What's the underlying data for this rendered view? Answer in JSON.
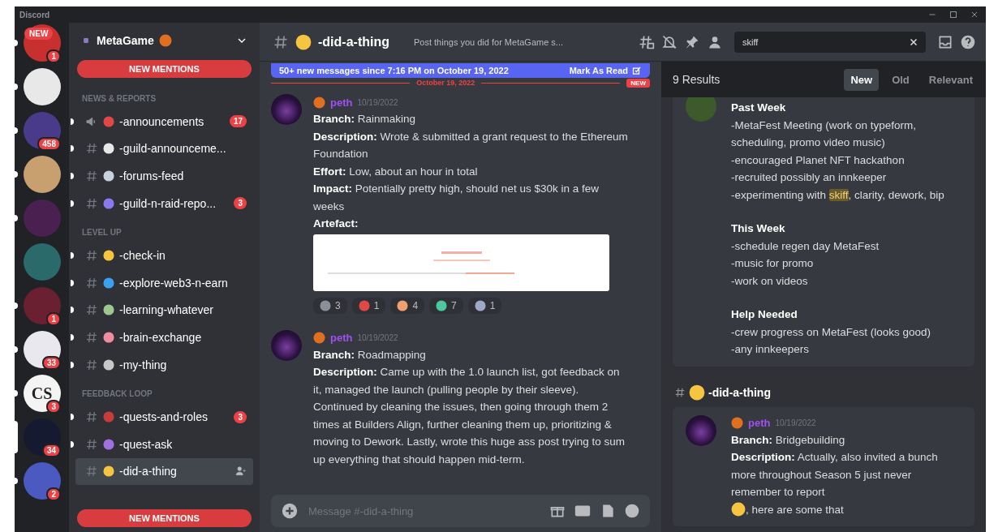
{
  "window": {
    "title": "Discord"
  },
  "servers": [
    {
      "tag": "NEW",
      "badge": "1",
      "unread": true,
      "selected": false
    },
    {
      "unread": true,
      "selected": false
    },
    {
      "badge": "458",
      "unread": true,
      "selected": false
    },
    {
      "unread": true,
      "selected": false
    },
    {
      "unread": true,
      "selected": false
    },
    {
      "unread": false,
      "selected": false
    },
    {
      "badge": "1",
      "unread": true,
      "selected": false
    },
    {
      "badge": "33",
      "unread": true,
      "selected": false
    },
    {
      "label": "CS",
      "badge": "3",
      "unread": true,
      "selected": false
    },
    {
      "badge": "34",
      "unread": false,
      "selected": true
    },
    {
      "badge": "2",
      "unread": true,
      "selected": false
    }
  ],
  "sidebar": {
    "server_name": "MetaGame",
    "top_pill": "NEW MENTIONS",
    "bottom_pill": "NEW MENTIONS",
    "categories": [
      {
        "name": "NEWS & REPORTS",
        "channels": [
          {
            "kind": "announcement",
            "name": "-announcements",
            "color": "#e04848",
            "badge": "17",
            "unread": true,
            "selected": false
          },
          {
            "kind": "text",
            "name": "-guild-announceme...",
            "color": "#e8e8e8",
            "unread": true,
            "selected": false
          },
          {
            "kind": "text",
            "name": "-forums-feed",
            "color": "#c8d0dc",
            "unread": true,
            "selected": false
          },
          {
            "kind": "text",
            "name": "-guild-n-raid-repo...",
            "color": "#8a78f0",
            "badge": "3",
            "unread": true,
            "selected": false
          }
        ]
      },
      {
        "name": "LEVEL UP",
        "channels": [
          {
            "kind": "text",
            "name": "-check-in",
            "color": "#f5c542",
            "unread": true,
            "selected": false
          },
          {
            "kind": "text",
            "name": "-explore-web3-n-earn",
            "color": "#3aa0f0",
            "unread": true,
            "selected": false
          },
          {
            "kind": "text",
            "name": "-learning-whatever",
            "color": "#9cc890",
            "unread": true,
            "selected": false
          },
          {
            "kind": "text",
            "name": "-brain-exchange",
            "color": "#f08ca0",
            "unread": true,
            "selected": false
          },
          {
            "kind": "text",
            "name": "-my-thing",
            "color": "#c8c8c8",
            "unread": true,
            "selected": false
          }
        ]
      },
      {
        "name": "FEEDBACK LOOP",
        "channels": [
          {
            "kind": "text",
            "name": "-quests-and-roles",
            "color": "#c83c3c",
            "badge": "3",
            "unread": true,
            "selected": false
          },
          {
            "kind": "text",
            "name": "-quest-ask",
            "color": "#a070e0",
            "unread": true,
            "selected": false
          },
          {
            "kind": "text",
            "name": "-did-a-thing",
            "color": "#f5c542",
            "unread": false,
            "selected": true
          }
        ]
      }
    ]
  },
  "header": {
    "channel": "-did-a-thing",
    "topic": "Post things you did for MetaGame s...",
    "search": {
      "value": "skiff"
    }
  },
  "chat": {
    "new_messages": "50+ new messages since 7:16 PM on October 19, 2022",
    "mark_read": "Mark As Read",
    "divider": "October 19, 2022",
    "divider_badge": "NEW",
    "messages": [
      {
        "author": "peth",
        "time": "10/19/2022",
        "fields": [
          "**Branch:** Rainmaking",
          "**Description:** Wrote & submitted a grant request to the Ethereum Foundation",
          "**Effort:** Low, about an hour in total",
          "**Impact:** Potentially pretty high, should net us $30k in a few weeks"
        ],
        "artefact_label": "Artefact:",
        "reactions": [
          {
            "count": "3",
            "color": "#8a8f98"
          },
          {
            "count": "1",
            "color": "#e04848"
          },
          {
            "count": "4",
            "color": "#f0a070"
          },
          {
            "count": "7",
            "color": "#4cc8a0"
          },
          {
            "count": "1",
            "color": "#a0a8c8"
          }
        ]
      },
      {
        "author": "peth",
        "time": "10/19/2022",
        "fields": [
          "**Branch:** Roadmapping",
          "**Description:** Came up with the 1.0 launch list, got feedback on it, managed the launch (pulling people by their sleeve). Continued by cleaning the issues, then going through them 2 times at Builders Align, further cleaning them up, prioritizing & moving to Dework. Lastly, wrote this huge ass post trying to sum up everything that should happen mid-term."
        ]
      }
    ],
    "composer": {
      "placeholder": "Message #-did-a-thing"
    }
  },
  "results": {
    "count": "9 Results",
    "sort_tabs": [
      {
        "label": "New",
        "selected": true
      },
      {
        "label": "Old",
        "selected": false
      },
      {
        "label": "Relevant",
        "selected": false
      }
    ],
    "first": {
      "sections": [
        {
          "heading": "Past Week",
          "lines": [
            "-MetaFest Meeting (work on typeform, scheduling, promo video music)",
            "-encouraged Planet NFT hackathon",
            "-recruited possibly an innkeeper",
            {
              "before": "-experimenting with ",
              "highlight": "skiff",
              "after": ", clarity, dework, bip"
            }
          ]
        },
        {
          "heading": "This Week",
          "lines": [
            "-schedule regen day MetaFest",
            "-music for promo",
            "-work on  videos"
          ]
        },
        {
          "heading": "Help Needed",
          "lines": [
            "-crew progress on MetaFest (looks good)",
            "-any innkeepers"
          ]
        }
      ]
    },
    "channel": "-did-a-thing",
    "second": {
      "author": "peth",
      "time": "10/19/2022",
      "branch": "**Branch:** Bridgebuilding",
      "description": "**Description:** Actually, also invited a bunch more throughout Season 5 just never remember to report",
      "description_end": ", here are some that"
    }
  }
}
